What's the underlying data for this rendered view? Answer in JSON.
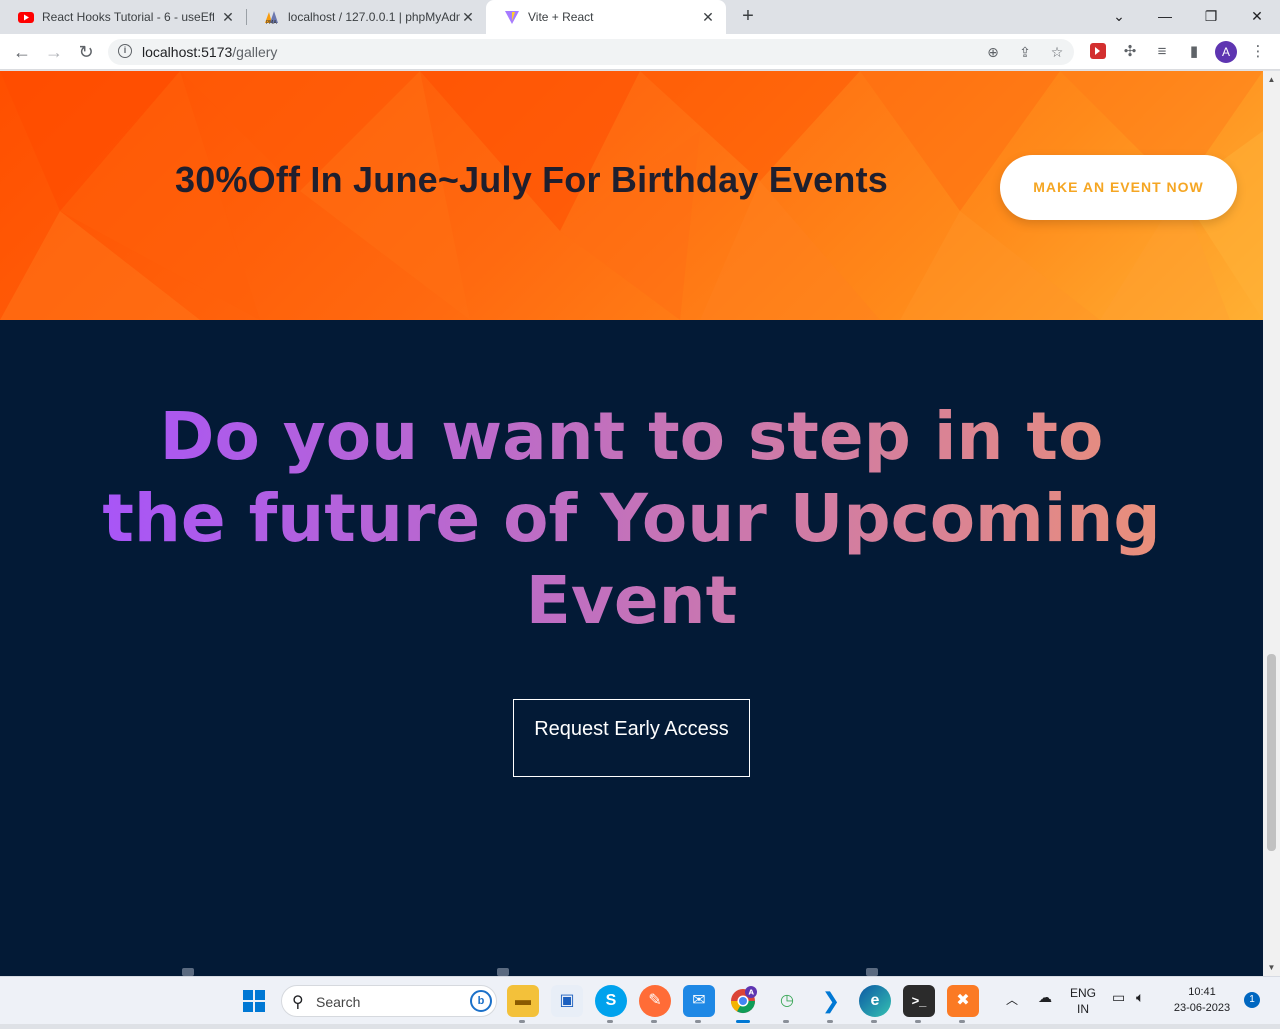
{
  "browser": {
    "tabs": [
      {
        "title": "React Hooks Tutorial - 6 - useEffe",
        "favicon": "youtube-icon",
        "active": false
      },
      {
        "title": "localhost / 127.0.0.1 | phpMyAdm",
        "favicon": "phpmyadmin-icon",
        "active": false
      },
      {
        "title": "Vite + React",
        "favicon": "vite-icon",
        "active": true
      }
    ],
    "new_tab_label": "+",
    "url_host": "localhost:5173",
    "url_path": "/gallery",
    "profile_initial": "A"
  },
  "page": {
    "promo": {
      "text": "30%Off In June~July For Birthday Events",
      "button_label": "MAKE AN EVENT NOW"
    },
    "hero": {
      "title": "Do you want to step in to the future of Your Upcoming Event",
      "cta_label": "Request Early Access"
    },
    "colors": {
      "promo_orange": "#ff6a10",
      "hero_background": "#031a36",
      "gradient_start": "#a855f7",
      "gradient_end": "#e98f7a",
      "button_text": "#f5a623"
    }
  },
  "taskbar": {
    "search_placeholder": "Search",
    "language_line1": "ENG",
    "language_line2": "IN",
    "time": "10:41",
    "date": "23-06-2023",
    "notification_count": "1",
    "apps": [
      "file-explorer-icon",
      "app-icon",
      "skype-icon",
      "postman-icon",
      "mail-icon",
      "chrome-icon",
      "clock-app-icon",
      "vscode-icon",
      "edge-icon",
      "terminal-icon",
      "xampp-icon"
    ]
  }
}
